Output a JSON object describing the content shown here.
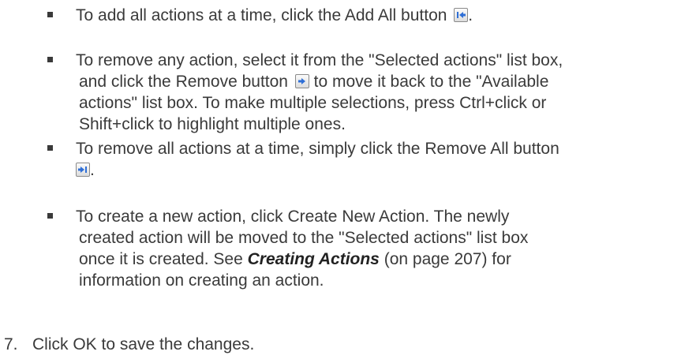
{
  "bullets": [
    {
      "lines": [
        {
          "before": "To add all actions at a time, click the Add All button ",
          "icon": "add-all-icon",
          "after": "."
        }
      ]
    },
    {
      "lines": [
        {
          "text": "To remove any action, select it from the \"Selected actions\" list box,"
        },
        {
          "before": "and click the Remove button ",
          "icon": "remove-icon",
          "after": " to move it back to the \"Available"
        },
        {
          "text": "actions\" list box. To make multiple selections, press Ctrl+click or"
        },
        {
          "text": "Shift+click to highlight multiple ones."
        }
      ]
    },
    {
      "lines": [
        {
          "text": "To remove all actions at a time, simply click the Remove All button"
        },
        {
          "before": "",
          "icon": "remove-all-icon",
          "after": "."
        }
      ]
    },
    {
      "lines": [
        {
          "text": "To create a new action, click Create New Action. The newly"
        },
        {
          "text": "created action will be moved to the \"Selected actions\" list box"
        },
        {
          "before": "once it is created. See ",
          "link": "Creating Actions",
          "after": " (on page 207) for"
        },
        {
          "text": "information on creating an action."
        }
      ]
    }
  ],
  "step": {
    "number": "7.",
    "text": "Click OK to save the changes."
  },
  "colors": {
    "text": "#3a3a3a",
    "icon_arrow": "#2f6fd6"
  }
}
